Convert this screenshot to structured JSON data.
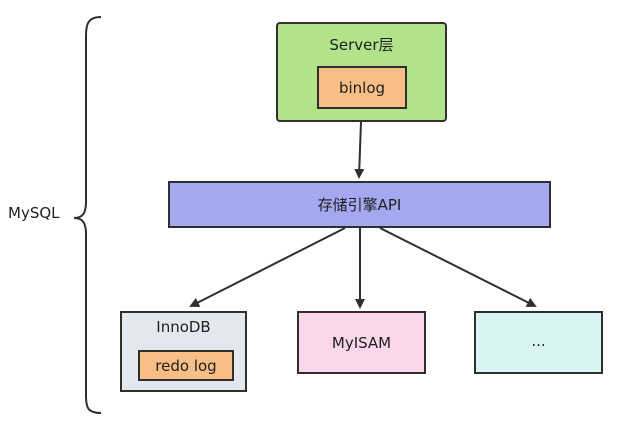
{
  "server_layer": {
    "title": "Server层",
    "binlog": "binlog"
  },
  "storage_api": {
    "label": "存储引擎API"
  },
  "engines": {
    "innodb": {
      "title": "InnoDB",
      "redo_log": "redo log"
    },
    "myisam": {
      "label": "MyISAM"
    },
    "others": {
      "label": "..."
    }
  },
  "mysql": {
    "label": "MySQL"
  },
  "colors": {
    "server_fill": "#b1e38b",
    "log_fill": "#f7bf86",
    "api_fill": "#a4a8f1",
    "innodb_fill": "#e4e8ee",
    "myisam_fill": "#f9d6ea",
    "others_fill": "#d8f4f3",
    "stroke": "#2f2f2f"
  }
}
